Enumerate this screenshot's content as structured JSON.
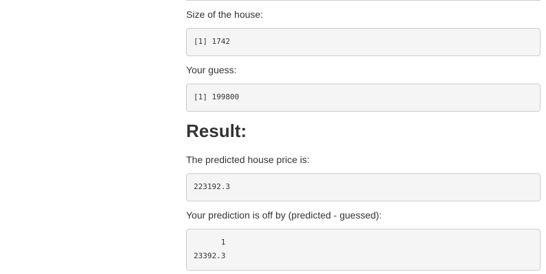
{
  "fields": {
    "size_label": "Size of the house:",
    "size_output": "[1] 1742",
    "guess_label": "Your guess:",
    "guess_output": "[1] 199800"
  },
  "result": {
    "heading": "Result:",
    "predicted_label": "The predicted house price is:",
    "predicted_output": "223192.3",
    "offby_label": "Your prediction is off by (predicted - guessed):",
    "offby_output": "      1\n23392.3"
  }
}
